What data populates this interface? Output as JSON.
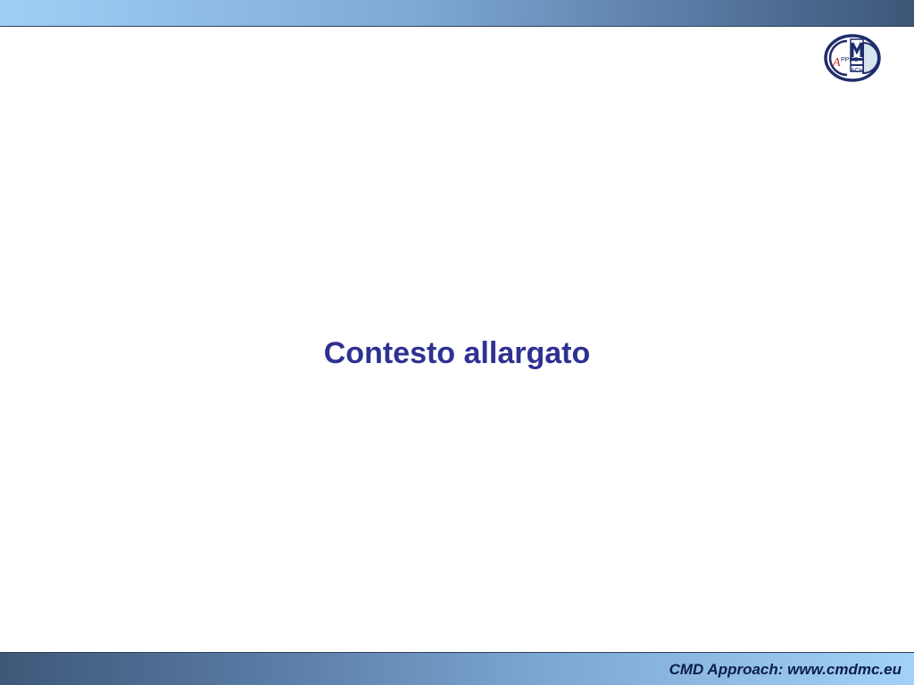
{
  "slide": {
    "title": "Contesto allargato",
    "footer": "CMD Approach: www.cmdmc.eu"
  },
  "logo": {
    "icon": "cmd-approach-logo-icon",
    "letter_a": "A",
    "letters_ppro": "PPRO",
    "letters_ach": "ACH",
    "colors": {
      "ring": "#1f2d6b",
      "accent": "#c1272d"
    }
  },
  "colors": {
    "title": "#2e3192",
    "footer_text": "#0b1f4a",
    "bar_light": "#9fcff7",
    "bar_dark": "#3c5677"
  }
}
